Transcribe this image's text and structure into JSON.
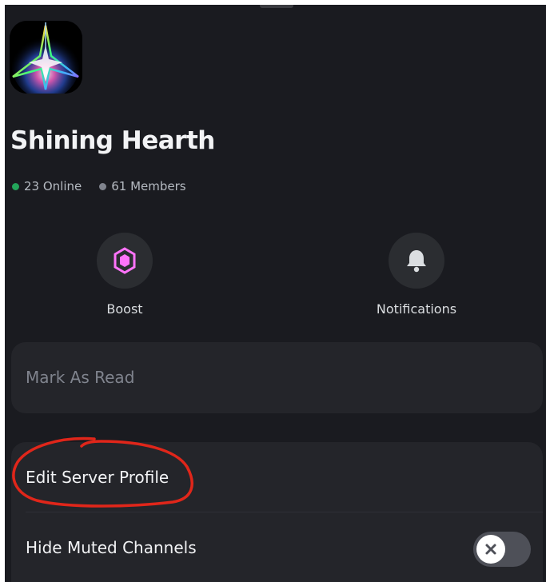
{
  "server": {
    "name": "Shining Hearth",
    "icon": "prismatic-star-logo"
  },
  "stats": {
    "online": "23 Online",
    "members": "61 Members",
    "online_color": "#23a55a",
    "members_color": "#80848e"
  },
  "actions": [
    {
      "label": "Boost",
      "icon": "boost-gem-icon",
      "icon_color": "#ff73fa"
    },
    {
      "label": "Notifications",
      "icon": "bell-icon",
      "icon_color": "#dbdee1"
    }
  ],
  "menu": {
    "mark_as_read": "Mark As Read",
    "edit_server_profile": "Edit Server Profile",
    "hide_muted_channels": "Hide Muted Channels",
    "hide_muted_toggle_on": false
  },
  "annotation": {
    "target": "edit-server-profile",
    "color": "#e0261a"
  },
  "colors": {
    "background": "#1a1b20",
    "card": "#24252a"
  }
}
